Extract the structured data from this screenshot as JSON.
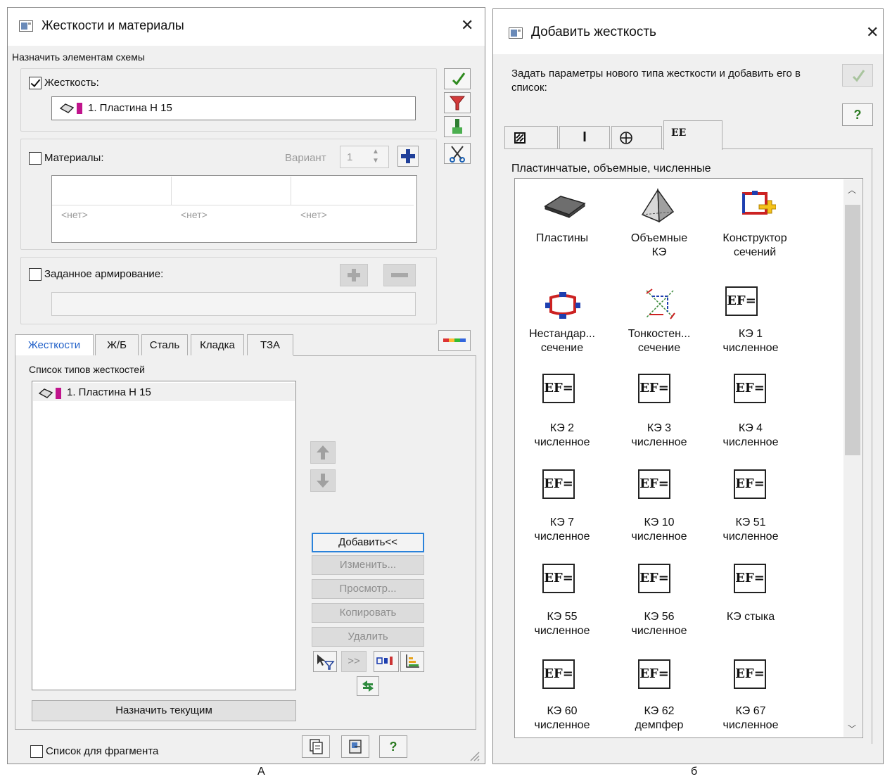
{
  "left": {
    "title": "Жесткости и материалы",
    "close": "✕",
    "assign_heading": "Назначить элементам схемы",
    "stiffness": {
      "label": "Жесткость:",
      "checked": true,
      "value": "1. Пластина  Н 15"
    },
    "materials": {
      "label": "Материалы:",
      "checked": false,
      "variant_label": "Вариант",
      "variant_value": "1",
      "cells": [
        "<нет>",
        "<нет>",
        "<нет>"
      ]
    },
    "reinforcement": {
      "label": "Заданное армирование:",
      "checked": false
    },
    "tabs": [
      "Жесткости",
      "Ж/Б",
      "Сталь",
      "Кладка",
      "ТЗА"
    ],
    "list_title": "Список типов жесткостей",
    "list_items": [
      "1. Пластина  Н 15"
    ],
    "buttons": {
      "add": "Добавить<<",
      "edit": "Изменить...",
      "view": "Просмотр...",
      "copy": "Копировать",
      "delete": "Удалить",
      "assign_current": "Назначить текущим",
      "more": ">>"
    },
    "fragment_label": "Список для фрагмента",
    "fragment_checked": false,
    "help": "?",
    "caption": "А"
  },
  "right": {
    "title": "Добавить жесткость",
    "close": "✕",
    "description": "Задать параметры нового типа жесткости и добавить его в список:",
    "help": "?",
    "tab_icons": [
      "hatched-square",
      "I-beam",
      "circle-cross",
      "EE"
    ],
    "tab_ee_label": "EE",
    "category": "Пластинчатые, объемные, численные",
    "items": [
      {
        "line1": "Пластины",
        "line2": "",
        "icon": "plate-icon"
      },
      {
        "line1": "Объемные",
        "line2": "КЭ",
        "icon": "pyramid-icon"
      },
      {
        "line1": "Конструктор",
        "line2": "сечений",
        "icon": "section-constructor-icon"
      },
      {
        "line1": "Нестандар...",
        "line2": "сечение",
        "icon": "nonstandard-section-icon"
      },
      {
        "line1": "Тонкостен...",
        "line2": "сечение",
        "icon": "thin-walled-section-icon"
      },
      {
        "line1": "КЭ 1",
        "line2": "численное",
        "icon": "ef-icon"
      },
      {
        "line1": "КЭ 2",
        "line2": "численное",
        "icon": "ef-icon"
      },
      {
        "line1": "КЭ 3",
        "line2": "численное",
        "icon": "ef-icon"
      },
      {
        "line1": "КЭ 4",
        "line2": "численное",
        "icon": "ef-icon"
      },
      {
        "line1": "КЭ 7",
        "line2": "численное",
        "icon": "ef-icon"
      },
      {
        "line1": "КЭ 10",
        "line2": "численное",
        "icon": "ef-icon"
      },
      {
        "line1": "КЭ 51",
        "line2": "численное",
        "icon": "ef-icon"
      },
      {
        "line1": "КЭ 55",
        "line2": "численное",
        "icon": "ef-icon"
      },
      {
        "line1": "КЭ 56",
        "line2": "численное",
        "icon": "ef-icon"
      },
      {
        "line1": "КЭ стыка",
        "line2": "",
        "icon": "ef-icon"
      },
      {
        "line1": "КЭ 60",
        "line2": "численное",
        "icon": "ef-icon"
      },
      {
        "line1": "КЭ 62",
        "line2": "демпфер",
        "icon": "ef-icon"
      },
      {
        "line1": "КЭ 67",
        "line2": "численное",
        "icon": "ef-icon"
      }
    ],
    "ef_text": "EF=",
    "caption": "б"
  }
}
